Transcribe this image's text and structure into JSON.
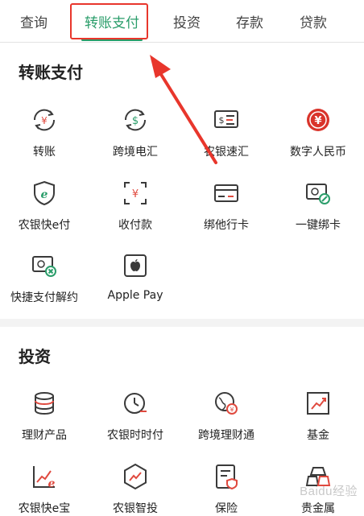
{
  "tabs": [
    {
      "label": "查询"
    },
    {
      "label": "转账支付",
      "active": true
    },
    {
      "label": "投资"
    },
    {
      "label": "存款"
    },
    {
      "label": "贷款"
    }
  ],
  "sections": {
    "transfer": {
      "title": "转账支付",
      "items": [
        {
          "label": "转账",
          "icon": "yuan-circle-arrows-icon"
        },
        {
          "label": "跨境电汇",
          "icon": "dollar-circle-arrows-icon"
        },
        {
          "label": "农银速汇",
          "icon": "fast-remittance-icon"
        },
        {
          "label": "数字人民币",
          "icon": "digital-rmb-icon"
        },
        {
          "label": "农银快e付",
          "icon": "shield-e-icon"
        },
        {
          "label": "收付款",
          "icon": "scan-yuan-icon"
        },
        {
          "label": "绑他行卡",
          "icon": "bank-card-icon"
        },
        {
          "label": "一键绑卡",
          "icon": "card-link-icon"
        },
        {
          "label": "快捷支付解约",
          "icon": "card-cancel-icon"
        },
        {
          "label": "Apple Pay",
          "icon": "apple-pay-icon"
        }
      ]
    },
    "invest": {
      "title": "投资",
      "items": [
        {
          "label": "理财产品",
          "icon": "coin-stack-icon"
        },
        {
          "label": "农银时时付",
          "icon": "clock-pay-icon"
        },
        {
          "label": "跨境理财通",
          "icon": "globe-exchange-icon"
        },
        {
          "label": "基金",
          "icon": "fund-chart-icon"
        },
        {
          "label": "农银快e宝",
          "icon": "chart-e-icon"
        },
        {
          "label": "农银智投",
          "icon": "hexagon-chart-icon"
        },
        {
          "label": "保险",
          "icon": "insurance-doc-icon"
        },
        {
          "label": "贵金属",
          "icon": "gold-bar-icon"
        }
      ]
    }
  },
  "colors": {
    "accent": "#2a9d6a",
    "icon_red": "#e04a3f",
    "icon_dark": "#3a3a3a",
    "highlight": "#e8362c"
  },
  "watermark": "Baidu经验"
}
